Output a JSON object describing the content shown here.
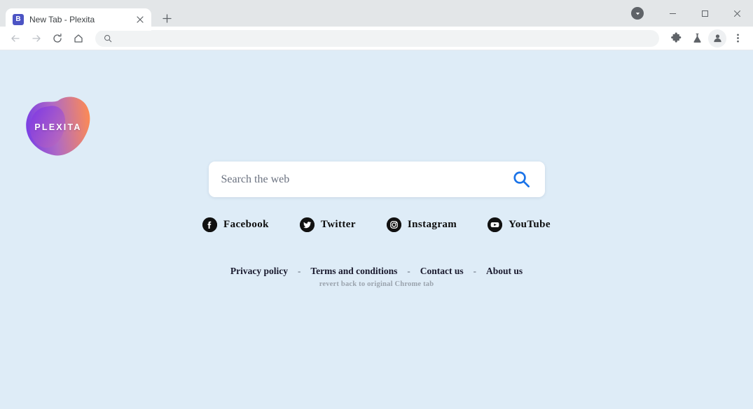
{
  "browser": {
    "tab": {
      "title": "New Tab - Plexita",
      "favicon_letter": "B",
      "favicon_color": "#4c54c4",
      "close_icon": "close-icon"
    },
    "new_tab_button_icon": "plus-icon",
    "download_badge_icon": "download-chevron-icon",
    "window_controls": {
      "minimize": "minimize-icon",
      "maximize": "maximize-icon",
      "close": "close-icon"
    },
    "toolbar": {
      "back_icon": "arrow-left-icon",
      "forward_icon": "arrow-right-icon",
      "reload_icon": "reload-icon",
      "home_icon": "home-icon",
      "omnibox": {
        "value": "",
        "placeholder": "",
        "icon": "search-icon"
      },
      "extensions_icon": "puzzle-icon",
      "labs_icon": "beaker-icon",
      "profile_icon": "person-avatar-icon",
      "menu_icon": "three-dot-menu-icon"
    }
  },
  "page": {
    "background_color": "#deecf7",
    "logo": {
      "text": "PLEXITA",
      "gradient_from": "#7b3fe4",
      "gradient_mid": "#b566c8",
      "gradient_to": "#f98b5a"
    },
    "search": {
      "value": "",
      "placeholder": "Search the web",
      "button_icon": "search-icon",
      "button_color": "#1a73e8"
    },
    "social_links": [
      {
        "label": "Facebook",
        "icon": "facebook-icon"
      },
      {
        "label": "Twitter",
        "icon": "twitter-icon"
      },
      {
        "label": "Instagram",
        "icon": "instagram-icon"
      },
      {
        "label": "YouTube",
        "icon": "youtube-icon"
      }
    ],
    "footer": {
      "links": [
        {
          "label": "Privacy policy"
        },
        {
          "label": "Terms and conditions"
        },
        {
          "label": "Contact us"
        },
        {
          "label": "About us"
        }
      ],
      "separator": "-",
      "revert_note": "revert back to original Chrome tab"
    }
  }
}
